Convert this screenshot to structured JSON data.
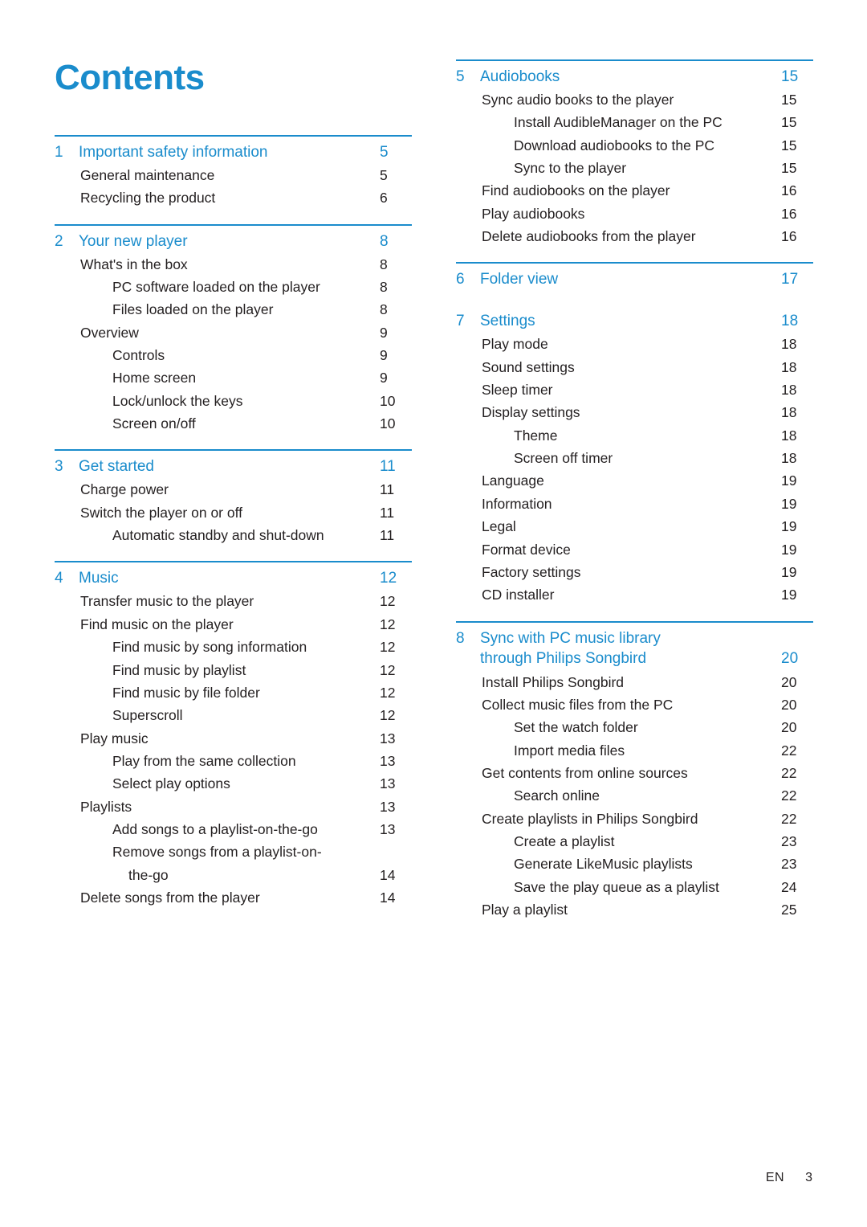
{
  "page": {
    "title": "Contents",
    "footer_lang": "EN",
    "footer_page": "3",
    "accent_color": "#1a8ccc",
    "text_color": "#231f20"
  },
  "left_column": [
    {
      "type": "chapter",
      "num": "1",
      "title": "Important safety information",
      "page": "5",
      "entries": [
        {
          "level": 1,
          "text": "General maintenance",
          "page": "5"
        },
        {
          "level": 1,
          "text": "Recycling the product",
          "page": "6"
        }
      ]
    },
    {
      "type": "chapter",
      "num": "2",
      "title": "Your new player",
      "page": "8",
      "entries": [
        {
          "level": 1,
          "text": "What's in the box",
          "page": "8"
        },
        {
          "level": 2,
          "text": "PC software loaded on the player",
          "page": "8"
        },
        {
          "level": 2,
          "text": "Files loaded on the player",
          "page": "8"
        },
        {
          "level": 1,
          "text": "Overview",
          "page": "9"
        },
        {
          "level": 2,
          "text": "Controls",
          "page": "9"
        },
        {
          "level": 2,
          "text": "Home screen",
          "page": "9"
        },
        {
          "level": 2,
          "text": "Lock/unlock the keys",
          "page": "10"
        },
        {
          "level": 2,
          "text": "Screen on/off",
          "page": "10"
        }
      ]
    },
    {
      "type": "chapter",
      "num": "3",
      "title": "Get started",
      "page": "11",
      "entries": [
        {
          "level": 1,
          "text": "Charge power",
          "page": "11"
        },
        {
          "level": 1,
          "text": "Switch the player on or off",
          "page": "11"
        },
        {
          "level": 2,
          "text": "Automatic standby and shut-down",
          "page": "11"
        }
      ]
    },
    {
      "type": "chapter",
      "num": "4",
      "title": "Music",
      "page": "12",
      "entries": [
        {
          "level": 1,
          "text": "Transfer music to the player",
          "page": "12"
        },
        {
          "level": 1,
          "text": "Find music on the player",
          "page": "12"
        },
        {
          "level": 2,
          "text": "Find music by song information",
          "page": "12"
        },
        {
          "level": 2,
          "text": "Find music by playlist",
          "page": "12"
        },
        {
          "level": 2,
          "text": "Find music by file folder",
          "page": "12"
        },
        {
          "level": 2,
          "text": "Superscroll",
          "page": "12"
        },
        {
          "level": 1,
          "text": "Play music",
          "page": "13"
        },
        {
          "level": 2,
          "text": "Play from the same collection",
          "page": "13"
        },
        {
          "level": 2,
          "text": "Select play options",
          "page": "13"
        },
        {
          "level": 1,
          "text": "Playlists",
          "page": "13"
        },
        {
          "level": 2,
          "text": "Add songs to a playlist-on-the-go",
          "page": "13"
        },
        {
          "level": 2,
          "text": "Remove songs from a playlist-on-",
          "page": ""
        },
        {
          "level": 3,
          "text": "the-go",
          "page": "14"
        },
        {
          "level": 1,
          "text": "Delete songs from the player",
          "page": "14"
        }
      ]
    }
  ],
  "right_column": [
    {
      "type": "chapter",
      "num": "5",
      "title": "Audiobooks",
      "page": "15",
      "entries": [
        {
          "level": 1,
          "text": "Sync audio books to the player",
          "page": "15"
        },
        {
          "level": 2,
          "text": "Install AudibleManager on the PC",
          "page": "15"
        },
        {
          "level": 2,
          "text": "Download audiobooks to the PC",
          "page": "15"
        },
        {
          "level": 2,
          "text": "Sync to the player",
          "page": "15"
        },
        {
          "level": 1,
          "text": "Find audiobooks on the player",
          "page": "16"
        },
        {
          "level": 1,
          "text": "Play audiobooks",
          "page": "16"
        },
        {
          "level": 1,
          "text": "Delete audiobooks from the player",
          "page": "16"
        }
      ]
    },
    {
      "type": "chapter",
      "num": "6",
      "title": "Folder view",
      "page": "17",
      "entries": []
    },
    {
      "type": "chapter",
      "num": "7",
      "title": "Settings",
      "page": "18",
      "no_rule": true,
      "entries": [
        {
          "level": 1,
          "text": "Play mode",
          "page": "18"
        },
        {
          "level": 1,
          "text": "Sound settings",
          "page": "18"
        },
        {
          "level": 1,
          "text": "Sleep timer",
          "page": "18"
        },
        {
          "level": 1,
          "text": "Display settings",
          "page": "18"
        },
        {
          "level": 2,
          "text": "Theme",
          "page": "18"
        },
        {
          "level": 2,
          "text": "Screen off timer",
          "page": "18"
        },
        {
          "level": 1,
          "text": "Language",
          "page": "19"
        },
        {
          "level": 1,
          "text": "Information",
          "page": "19"
        },
        {
          "level": 1,
          "text": "Legal",
          "page": "19"
        },
        {
          "level": 1,
          "text": "Format device",
          "page": "19"
        },
        {
          "level": 1,
          "text": "Factory settings",
          "page": "19"
        },
        {
          "level": 1,
          "text": "CD installer",
          "page": "19"
        }
      ]
    },
    {
      "type": "chapter",
      "num": "8",
      "title": "Sync with PC music library",
      "title2": "through Philips Songbird",
      "page": "20",
      "entries": [
        {
          "level": 1,
          "text": "Install Philips Songbird",
          "page": "20"
        },
        {
          "level": 1,
          "text": "Collect music files from the PC",
          "page": "20"
        },
        {
          "level": 2,
          "text": "Set the watch folder",
          "page": "20"
        },
        {
          "level": 2,
          "text": "Import media files",
          "page": "22"
        },
        {
          "level": 1,
          "text": "Get contents from online sources",
          "page": "22"
        },
        {
          "level": 2,
          "text": "Search online",
          "page": "22"
        },
        {
          "level": 1,
          "text": "Create playlists in Philips Songbird",
          "page": "22"
        },
        {
          "level": 2,
          "text": "Create a playlist",
          "page": "23"
        },
        {
          "level": 2,
          "text": "Generate LikeMusic playlists",
          "page": "23"
        },
        {
          "level": 2,
          "text": "Save the play queue as a playlist",
          "page": "24"
        },
        {
          "level": 1,
          "text": "Play a playlist",
          "page": "25"
        }
      ]
    }
  ]
}
